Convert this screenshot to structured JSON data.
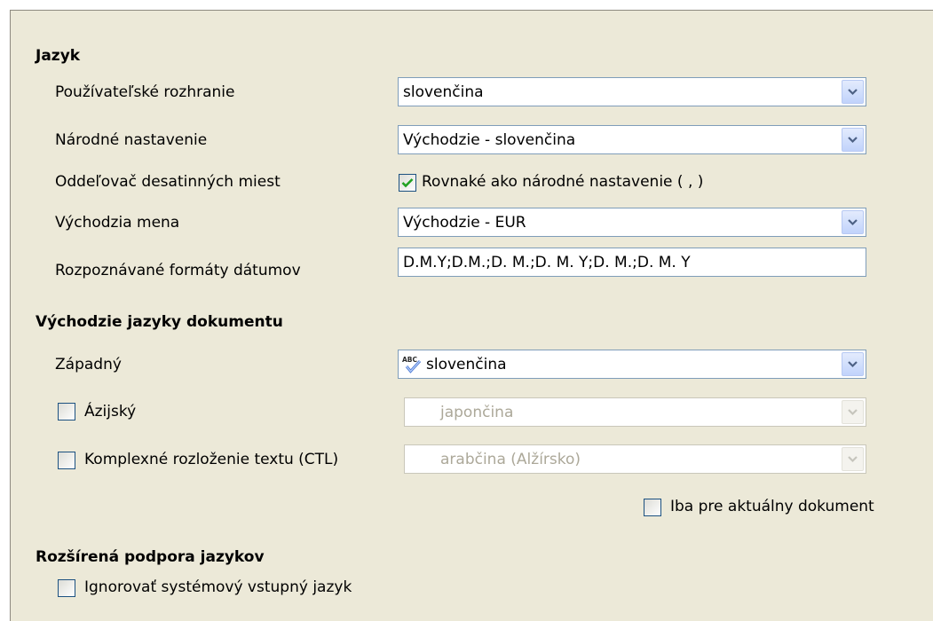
{
  "sections": {
    "language": {
      "title": "Jazyk",
      "user_interface": {
        "label": "Používateľské rozhranie",
        "value": "slovenčina"
      },
      "locale": {
        "label": "Národné nastavenie",
        "value": "Východzie - slovenčina"
      },
      "decimal_separator": {
        "label": "Oddeľovač desatinných miest",
        "checkbox_label": "Rovnaké ako národné nastavenie ( , )",
        "checked": true
      },
      "default_currency": {
        "label": "Východzia mena",
        "value": "Východzie - EUR"
      },
      "date_patterns": {
        "label": "Rozpoznávané formáty dátumov",
        "value": "D.M.Y;D.M.;D. M.;D. M. Y;D. M.;D. M. Y"
      }
    },
    "doc_languages": {
      "title": "Východzie jazyky dokumentu",
      "western": {
        "label": "Západný",
        "value": "slovenčina",
        "icon": "spellcheck-abc-icon"
      },
      "asian": {
        "label": "Ázijský",
        "value": "japončina",
        "checked": false
      },
      "ctl": {
        "label": "Komplexné rozloženie textu (CTL)",
        "value": "arabčina (Alžírsko)",
        "checked": false
      },
      "current_doc_only": {
        "label": "Iba pre aktuálny dokument",
        "checked": false
      }
    },
    "enhanced": {
      "title": "Rozšírená podpora jazykov",
      "ignore_system_input": {
        "label": "Ignorovať systémový vstupný jazyk",
        "checked": false
      }
    }
  },
  "colors": {
    "panel_background": "#ece9d8",
    "field_border": "#7f9db9",
    "checkbox_border": "#1c5180",
    "checkmark": "#21a121",
    "dropdown_arrow": "#4d6185",
    "disabled_text": "#aca899"
  }
}
